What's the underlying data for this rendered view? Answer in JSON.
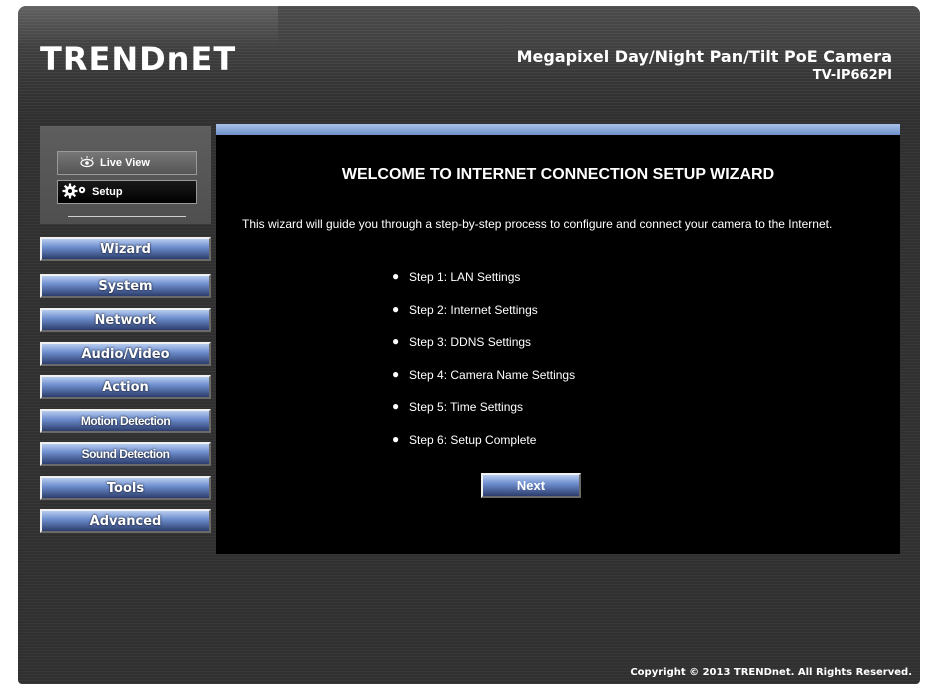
{
  "header": {
    "logo": "TRENDnET",
    "product_title": "Megapixel Day/Night Pan/Tilt PoE Camera",
    "model": "TV-IP662PI"
  },
  "mode": {
    "live_view_label": "Live View",
    "setup_label": "Setup"
  },
  "sidebar": {
    "items": [
      {
        "label": "Wizard"
      },
      {
        "label": "System"
      },
      {
        "label": "Network"
      },
      {
        "label": "Audio/Video"
      },
      {
        "label": "Action"
      },
      {
        "label": "Motion Detection"
      },
      {
        "label": "Sound Detection"
      },
      {
        "label": "Tools"
      },
      {
        "label": "Advanced"
      }
    ]
  },
  "main": {
    "title": "WELCOME TO INTERNET CONNECTION SETUP WIZARD",
    "intro": "This wizard will guide you through a step-by-step process to configure and connect your camera to the Internet.",
    "steps": [
      "Step 1: LAN Settings",
      "Step 2: Internet Settings",
      "Step 3: DDNS Settings",
      "Step 4: Camera Name Settings",
      "Step 5: Time Settings",
      "Step 6: Setup Complete"
    ],
    "next_label": "Next"
  },
  "footer": {
    "copyright": "Copyright © 2013 TRENDnet. All Rights Reserved."
  },
  "colors": {
    "accent": "#6f8fcf",
    "background": "#303030",
    "content_bg": "#000000"
  },
  "icons": [
    "eye-icon",
    "gear-icon"
  ]
}
